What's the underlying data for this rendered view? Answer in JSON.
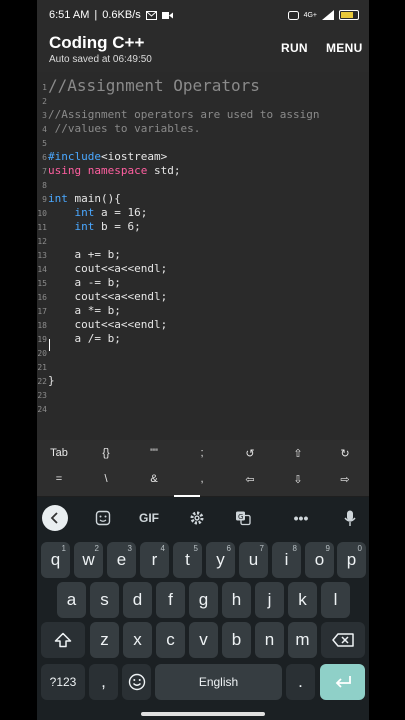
{
  "status": {
    "time": "6:51 AM",
    "speed": "0.6KB/s",
    "network": "4G+"
  },
  "app": {
    "title": "Coding C++",
    "subtitle": "Auto saved at 06:49:50",
    "run_label": "RUN",
    "menu_label": "MENU"
  },
  "code_lines": [
    {
      "n": "1",
      "text": "//Assignment Operators"
    },
    {
      "n": "2",
      "text": ""
    },
    {
      "n": "3",
      "text": "//Assignment operators are used to assign"
    },
    {
      "n": "4",
      "text": " //values to variables."
    },
    {
      "n": "5",
      "text": ""
    },
    {
      "n": "6",
      "text": "#include<iostream>"
    },
    {
      "n": "7",
      "text": "using namespace std;"
    },
    {
      "n": "8",
      "text": ""
    },
    {
      "n": "9",
      "text": "int main(){"
    },
    {
      "n": "10",
      "text": "    int a = 16;"
    },
    {
      "n": "11",
      "text": "    int b = 6;"
    },
    {
      "n": "12",
      "text": ""
    },
    {
      "n": "13",
      "text": "    a += b;"
    },
    {
      "n": "14",
      "text": "    cout<<a<<endl;"
    },
    {
      "n": "15",
      "text": "    a -= b;"
    },
    {
      "n": "16",
      "text": "    cout<<a<<endl;"
    },
    {
      "n": "17",
      "text": "    a *= b;"
    },
    {
      "n": "18",
      "text": "    cout<<a<<endl;"
    },
    {
      "n": "19",
      "text": "    a /= b;"
    },
    {
      "n": "20",
      "text": ""
    },
    {
      "n": "21",
      "text": ""
    },
    {
      "n": "22",
      "text": "}"
    },
    {
      "n": "23",
      "text": ""
    },
    {
      "n": "24",
      "text": ""
    }
  ],
  "code_parts": {
    "include_kw": "#include",
    "include_rest": "<iostream>",
    "using_kw": "using",
    "namespace_kw": "namespace",
    "std_rest": " std;",
    "int_kw": "int",
    "main_rest": " main(){",
    "a_decl": " a = 16;",
    "b_decl": " b = 6;"
  },
  "symbols_row1": [
    "Tab",
    "{}",
    "\"\"",
    ";",
    "↺",
    "⇧",
    "↻"
  ],
  "symbols_row2": [
    "=",
    "\\",
    "&",
    ",",
    "⇦",
    "⇩",
    "⇨"
  ],
  "keyboard": {
    "gif_label": "GIF",
    "row1": [
      {
        "k": "q",
        "alt": "1"
      },
      {
        "k": "w",
        "alt": "2"
      },
      {
        "k": "e",
        "alt": "3"
      },
      {
        "k": "r",
        "alt": "4"
      },
      {
        "k": "t",
        "alt": "5"
      },
      {
        "k": "y",
        "alt": "6"
      },
      {
        "k": "u",
        "alt": "7"
      },
      {
        "k": "i",
        "alt": "8"
      },
      {
        "k": "o",
        "alt": "9"
      },
      {
        "k": "p",
        "alt": "0"
      }
    ],
    "row2": [
      "a",
      "s",
      "d",
      "f",
      "g",
      "h",
      "j",
      "k",
      "l"
    ],
    "row3": [
      "z",
      "x",
      "c",
      "v",
      "b",
      "n",
      "m"
    ],
    "numbers_label": "?123",
    "comma": ",",
    "space_label": "English",
    "period": "."
  },
  "colors": {
    "keyword_blue": "#4aa8ff",
    "keyword_pink": "#ff5fa0",
    "enter_key": "#8fd0c8"
  }
}
